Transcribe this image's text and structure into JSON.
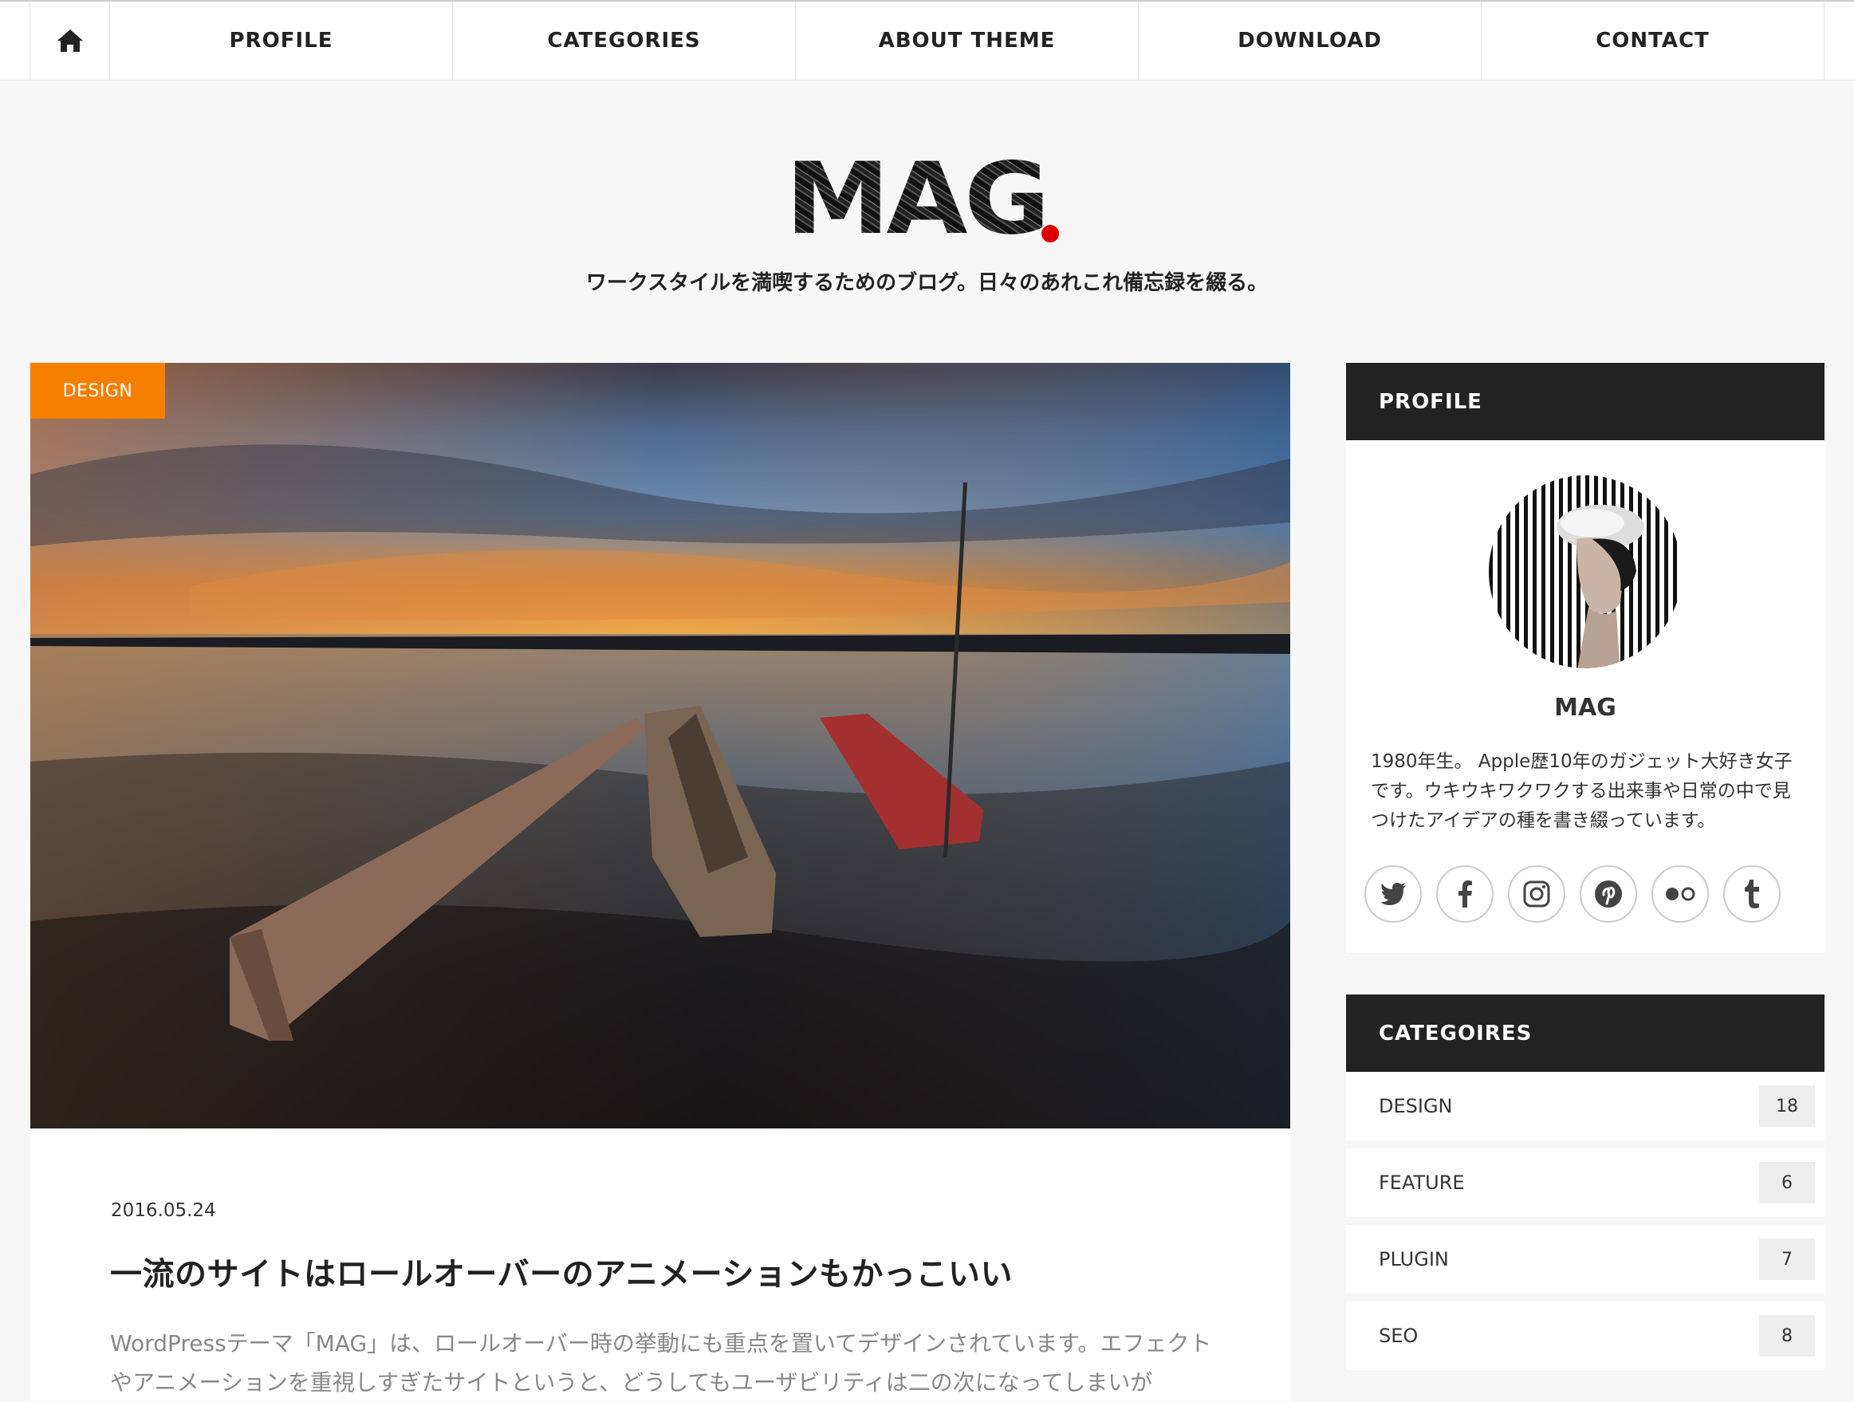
{
  "nav": {
    "items": [
      "PROFILE",
      "CATEGORIES",
      "ABOUT THEME",
      "DOWNLOAD",
      "CONTACT"
    ]
  },
  "header": {
    "logo": "MAG",
    "tagline": "ワークスタイルを満喫するためのブログ。日々のあれこれ備忘録を綴る。"
  },
  "post": {
    "category": "DESIGN",
    "date": "2016.05.24",
    "title": "一流のサイトはロールオーバーのアニメーションもかっこいい",
    "excerpt": "WordPressテーマ「MAG」は、ロールオーバー時の挙動にも重点を置いてデザインされています。エフェクトやアニメーションを重視しすぎたサイトというと、どうしてもユーザビリティは二の次になってしまいが"
  },
  "sidebar": {
    "profile": {
      "heading": "PROFILE",
      "name": "MAG",
      "bio": "1980年生。 Apple歴10年のガジェット大好き女子です。ウキウキワクワクする出来事や日常の中で見つけたアイデアの種を書き綴っています。",
      "social": [
        "twitter-icon",
        "facebook-icon",
        "instagram-icon",
        "pinterest-icon",
        "flickr-icon",
        "tumblr-icon"
      ]
    },
    "categories": {
      "heading": "CATEGOIRES",
      "items": [
        {
          "name": "DESIGN",
          "count": "18"
        },
        {
          "name": "FEATURE",
          "count": "6"
        },
        {
          "name": "PLUGIN",
          "count": "7"
        },
        {
          "name": "SEO",
          "count": "8"
        }
      ]
    }
  },
  "colors": {
    "accent": "#f77f00",
    "dark": "#222222",
    "logo_dot": "#dd0000",
    "background": "#f7f7f7"
  }
}
